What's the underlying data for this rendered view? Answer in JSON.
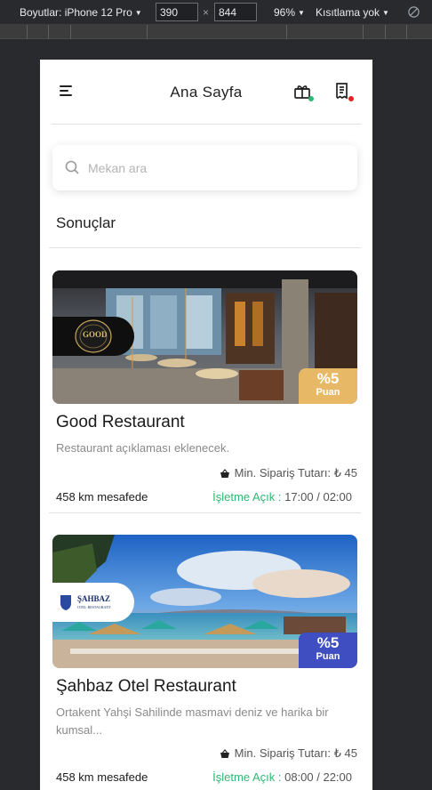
{
  "devtools": {
    "dimensions_label": "Boyutlar: iPhone 12 Pro",
    "width": "390",
    "height": "844",
    "times": "×",
    "zoom": "96%",
    "throttle": "Kısıtlama yok"
  },
  "app": {
    "title": "Ana Sayfa",
    "search_placeholder": "Mekan ara",
    "results_heading": "Sonuçlar"
  },
  "colors": {
    "accent_green": "#2eb873",
    "badge_gold": "#e7b967",
    "badge_blue": "#3f4fc2",
    "notify_green": "#2eb873",
    "notify_red": "#e02424"
  },
  "icons": {
    "menu": "menu-icon",
    "gift": "gift-icon",
    "receipt": "receipt-icon",
    "search": "search-icon",
    "basket": "basket-icon"
  },
  "restaurants": [
    {
      "name": "Good Restaurant",
      "logo_text": "GOOD",
      "description": "Restaurant açıklaması eklenecek.",
      "points_pct": "%5",
      "points_label": "Puan",
      "min_order": "Min. Sipariş Tutarı: ₺ 45",
      "distance": "458 km mesafede",
      "status_label": "İşletme Açık :",
      "hours": "17:00 / 02:00"
    },
    {
      "name": "Şahbaz Otel Restaurant",
      "logo_text": "ŞAHBAZ",
      "logo_sub": "OTEL·RESTAURANT",
      "description": "Ortakent Yahşi Sahilinde masmavi deniz ve harika bir kumsal...",
      "points_pct": "%5",
      "points_label": "Puan",
      "min_order": "Min. Sipariş Tutarı: ₺ 45",
      "distance": "458 km mesafede",
      "status_label": "İşletme Açık :",
      "hours": "08:00 / 22:00"
    }
  ]
}
